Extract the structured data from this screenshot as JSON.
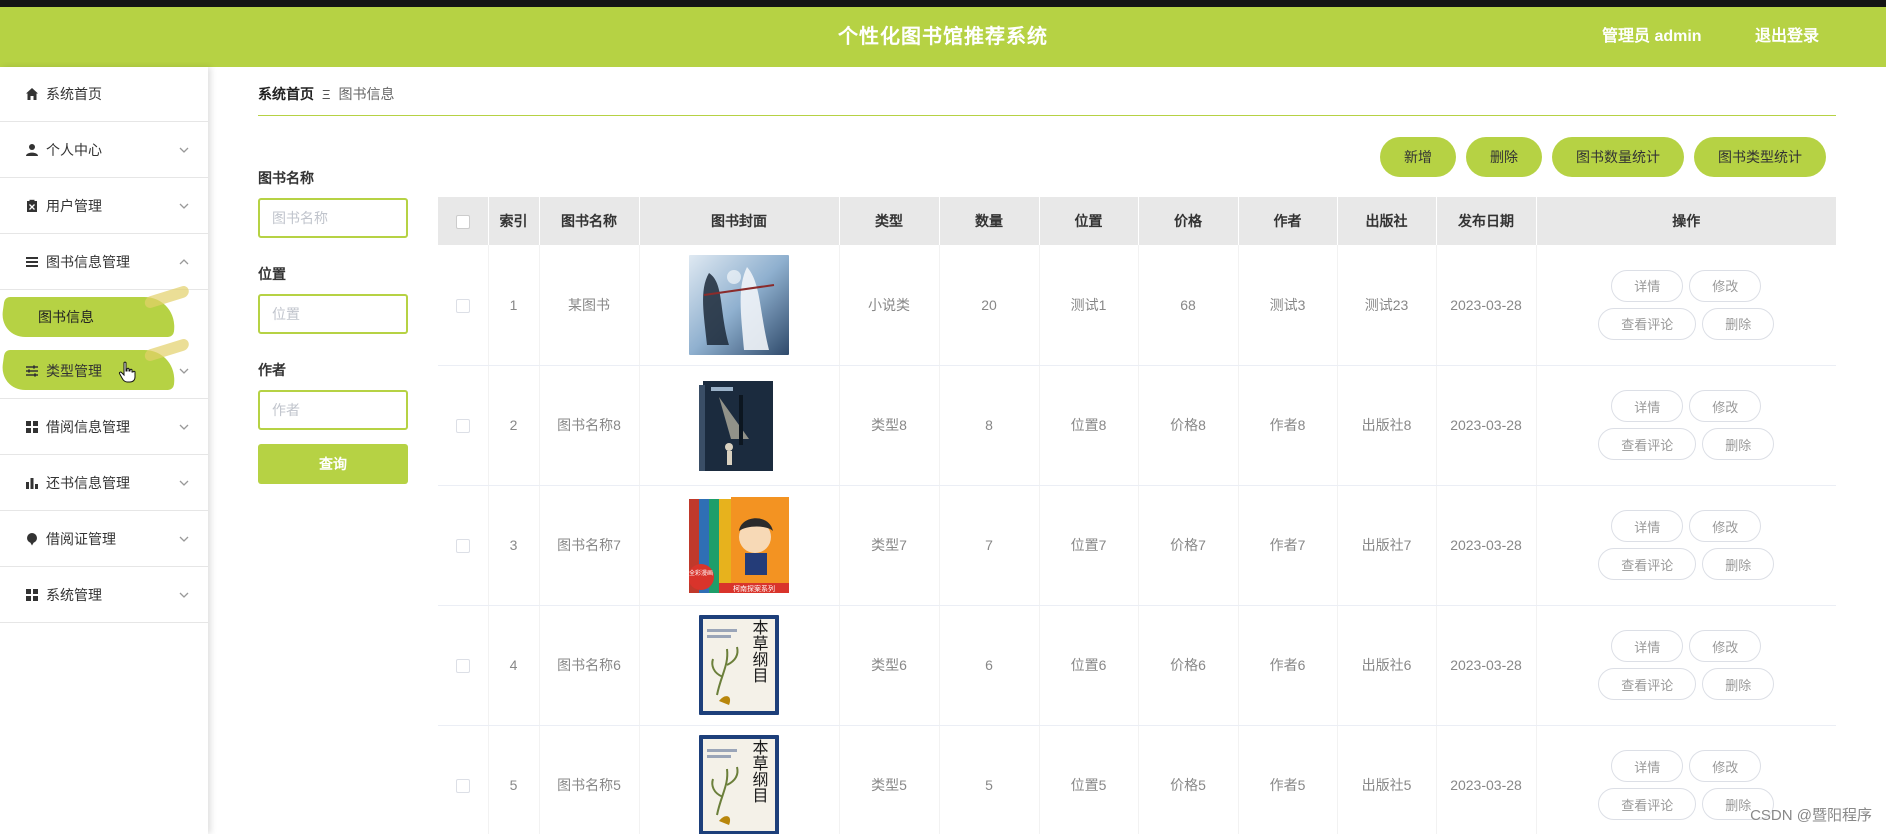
{
  "header": {
    "title": "个性化图书馆推荐系统",
    "user": "管理员 admin",
    "logout": "退出登录",
    "accent_color": "#b6d244"
  },
  "sidebar": {
    "items": [
      {
        "label": "系统首页",
        "icon": "home-icon"
      },
      {
        "label": "个人中心",
        "icon": "user-icon"
      },
      {
        "label": "用户管理",
        "icon": "clipboard-icon"
      },
      {
        "label": "图书信息管理",
        "icon": "list-icon",
        "expanded": true
      },
      {
        "label": "图书信息",
        "icon": "",
        "sub": true
      },
      {
        "label": "类型管理",
        "icon": "sliders-icon"
      },
      {
        "label": "借阅信息管理",
        "icon": "grid-icon"
      },
      {
        "label": "还书信息管理",
        "icon": "bar-chart-icon"
      },
      {
        "label": "借阅证管理",
        "icon": "pin-icon"
      },
      {
        "label": "系统管理",
        "icon": "grid-icon"
      }
    ]
  },
  "breadcrumb": {
    "home": "系统首页",
    "separator": "Ξ",
    "current": "图书信息"
  },
  "search": {
    "name_label": "图书名称",
    "name_placeholder": "图书名称",
    "name_value": "",
    "location_label": "位置",
    "location_placeholder": "位置",
    "location_value": "",
    "author_label": "作者",
    "author_placeholder": "作者",
    "author_value": "",
    "query_button": "查询"
  },
  "actions": {
    "add": "新增",
    "delete": "删除",
    "count_stats": "图书数量统计",
    "type_stats": "图书类型统计"
  },
  "table": {
    "columns": [
      "索引",
      "图书名称",
      "图书封面",
      "类型",
      "数量",
      "位置",
      "价格",
      "作者",
      "出版社",
      "发布日期",
      "操作"
    ],
    "rows": [
      {
        "index": "1",
        "name": "某图书",
        "cover": "fantasy-art-cover",
        "type": "小说类",
        "quantity": "20",
        "location": "测试1",
        "price": "68",
        "author": "测试3",
        "publisher": "测试23",
        "date": "2023-03-28"
      },
      {
        "index": "2",
        "name": "图书名称8",
        "cover": "night-street-cover",
        "type": "类型8",
        "quantity": "8",
        "location": "位置8",
        "price": "价格8",
        "author": "作者8",
        "publisher": "出版社8",
        "date": "2023-03-28"
      },
      {
        "index": "3",
        "name": "图书名称7",
        "cover": "comic-boxset-cover",
        "type": "类型7",
        "quantity": "7",
        "location": "位置7",
        "price": "价格7",
        "author": "作者7",
        "publisher": "出版社7",
        "date": "2023-03-28"
      },
      {
        "index": "4",
        "name": "图书名称6",
        "cover": "herbal-book-cover",
        "type": "类型6",
        "quantity": "6",
        "location": "位置6",
        "price": "价格6",
        "author": "作者6",
        "publisher": "出版社6",
        "date": "2023-03-28"
      },
      {
        "index": "5",
        "name": "图书名称5",
        "cover": "herbal-book-cover",
        "type": "类型5",
        "quantity": "5",
        "location": "位置5",
        "price": "价格5",
        "author": "作者5",
        "publisher": "出版社5",
        "date": "2023-03-28"
      }
    ],
    "op_labels": {
      "detail": "详情",
      "edit": "修改",
      "comments": "查看评论",
      "delete": "删除"
    }
  },
  "watermark": "CSDN @暨阳程序",
  "covers": {
    "herbal_title": "本草纲目",
    "comic_badge": "全彩漫画",
    "comic_series": "柯南探案系列"
  }
}
